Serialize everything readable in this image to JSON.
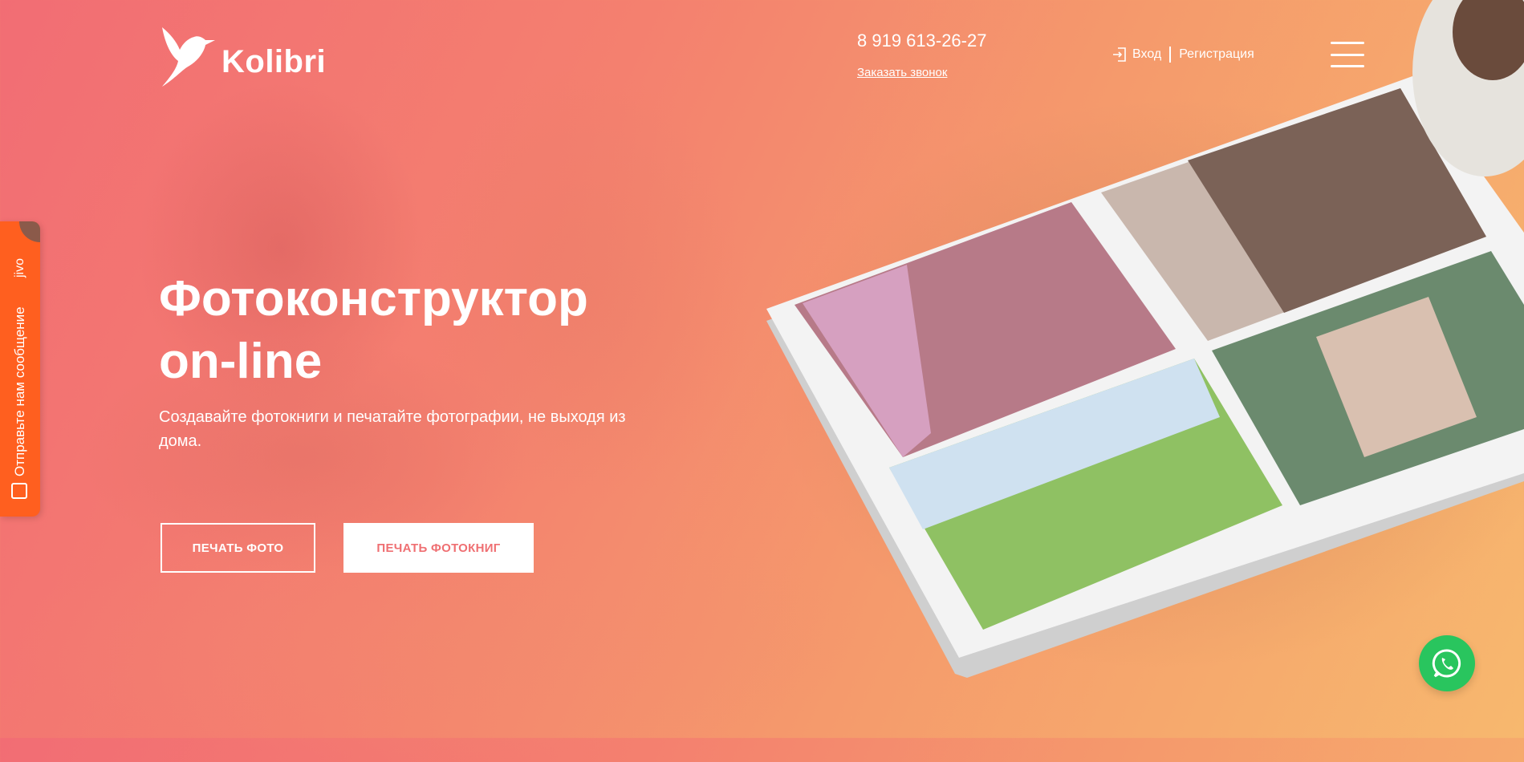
{
  "header": {
    "logo_text": "Kolibri",
    "phone": "8 919 613-26-27",
    "callback_label": "Заказать звонок",
    "login_label": "Вход",
    "register_label": "Регистрация"
  },
  "hero": {
    "title_line1": "Фотоконструктор",
    "title_line2": "on-line",
    "subtitle": "Создавайте фотокниги и печатайте фотографии, не выходя из дома.",
    "btn_print_photo": "ПЕЧАТЬ ФОТО",
    "btn_print_books": "ПЕЧАТЬ ФОТОКНИГ"
  },
  "chat_tab": {
    "brand": "jivo",
    "label": "Отправьте нам сообщение"
  },
  "colors": {
    "gradient_start": "#f26d74",
    "gradient_end": "#f7b86e",
    "chat_tab": "#ff5f1f",
    "whatsapp": "#29c55e",
    "button_text_accent": "#ef6f72"
  },
  "icons": {
    "logo": "hummingbird-icon",
    "login": "login-arrow-icon",
    "menu": "hamburger-icon",
    "chat": "chat-icon",
    "whatsapp": "whatsapp-icon"
  }
}
